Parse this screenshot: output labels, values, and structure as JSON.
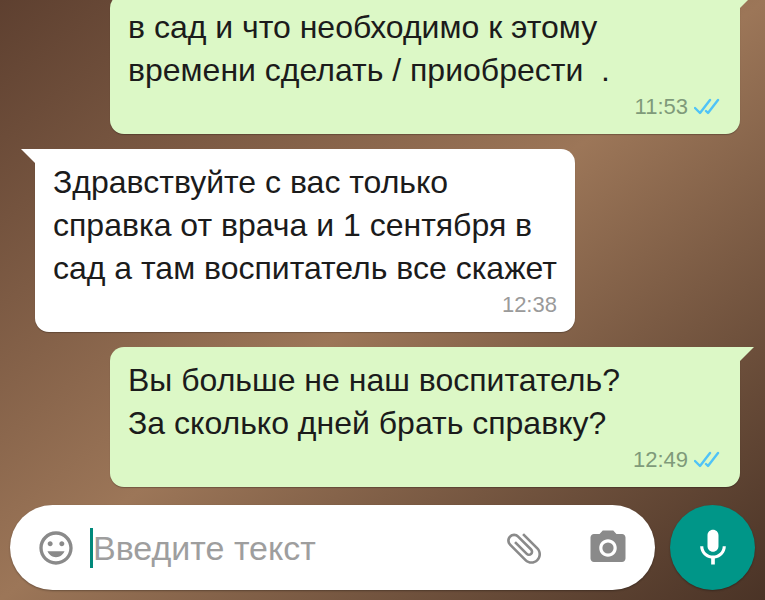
{
  "chat": {
    "messages": [
      {
        "kind": "outgoing",
        "lines": [
          "в сад и что необходимо к этому",
          "времени сделать / приобрести  ."
        ],
        "time": "11:53",
        "read": true
      },
      {
        "kind": "incoming",
        "lines": [
          "Здравствуйте с вас только",
          "справка от врача и 1 сентября в",
          "сад а там воспитатель все скажет"
        ],
        "time": "12:38"
      },
      {
        "kind": "outgoing",
        "lines": [
          "Вы больше не наш воспитатель?",
          "За сколько дней брать справку?"
        ],
        "time": "12:49",
        "read": true
      }
    ]
  },
  "composer": {
    "placeholder": "Введите текст"
  }
}
